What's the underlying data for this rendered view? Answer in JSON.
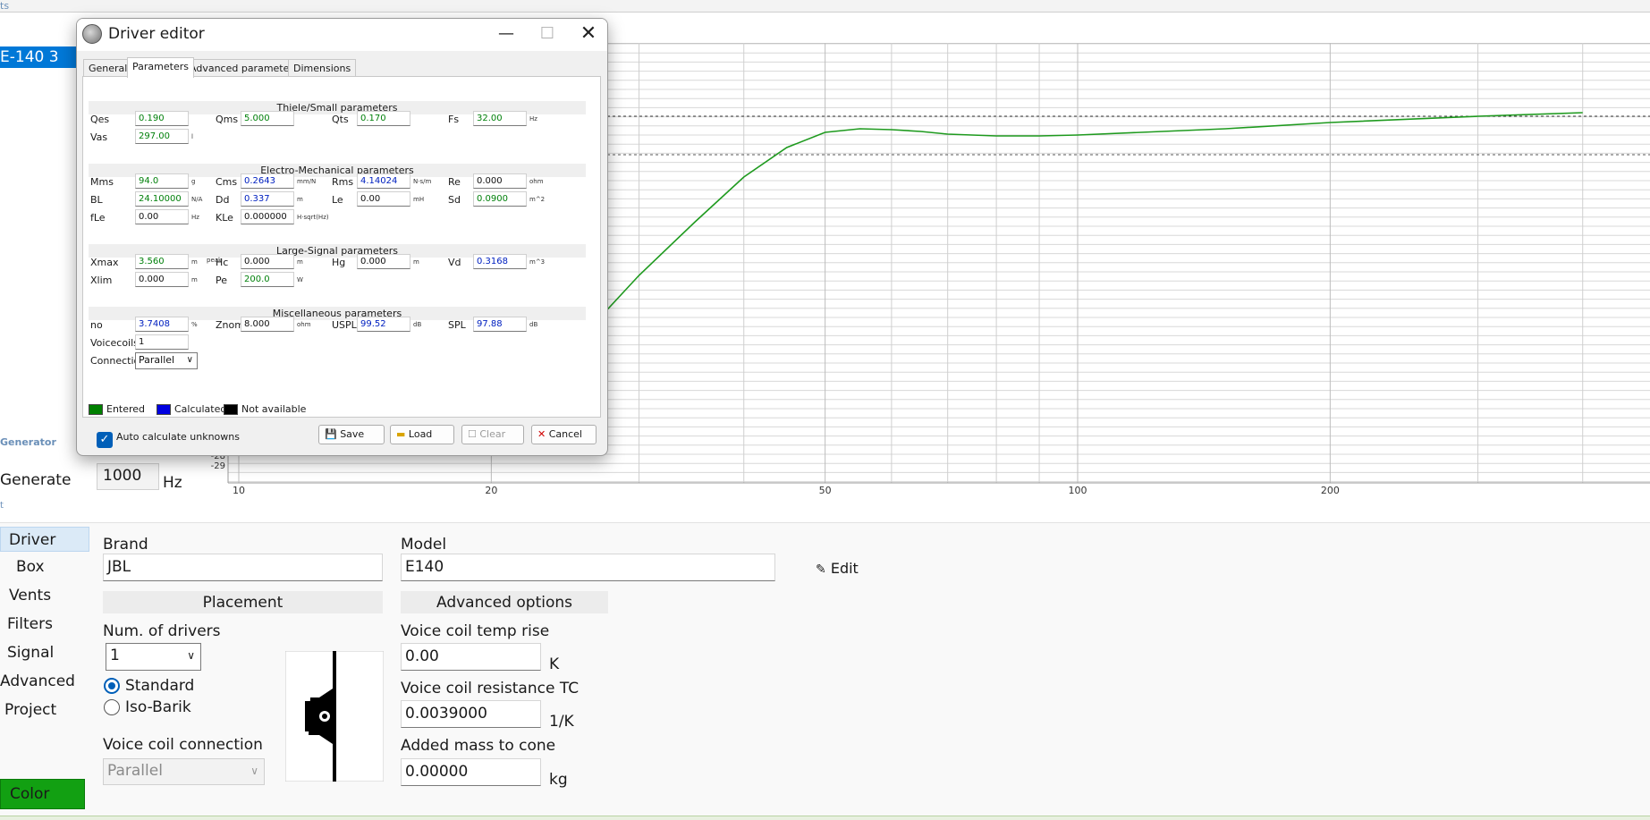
{
  "topstrip": {
    "text": "ts"
  },
  "project_list": {
    "selected": "E-140 3"
  },
  "generator": {
    "section_label": "Generator",
    "generate_label": "Generate",
    "frequency": "1000",
    "frequency_unit": "Hz",
    "marker": "t"
  },
  "chart_data": {
    "type": "line",
    "x_axis": {
      "scale": "log",
      "range": [
        8,
        400
      ],
      "tick_labels": [
        "10",
        "20",
        "50",
        "100",
        "200"
      ]
    },
    "y_axis": {
      "visible_tick_labels": [
        "-28",
        "-29"
      ]
    },
    "grid": true,
    "reference_lines": [
      {
        "style": "dashed"
      },
      {
        "style": "dashed"
      }
    ],
    "series": [
      {
        "color": "#1e9a1e",
        "x": [
          21,
          25,
          30,
          35,
          40,
          45,
          50,
          55,
          60,
          65,
          70,
          80,
          90,
          100,
          150,
          200,
          300,
          400
        ],
        "y": [
          -29,
          -22,
          -14,
          -8,
          -3,
          0.3,
          2.0,
          2.4,
          2.3,
          2.1,
          1.8,
          1.6,
          1.6,
          1.7,
          2.4,
          3.1,
          3.8,
          4.2
        ]
      }
    ]
  },
  "nav": {
    "driver": "Driver",
    "box": "Box",
    "vents": "Vents",
    "filters": "Filters",
    "signal": "Signal",
    "advanced": "Advanced",
    "project": "Project",
    "color": "Color"
  },
  "driver_tab": {
    "brand_label": "Brand",
    "brand_value": "JBL",
    "model_label": "Model",
    "model_value": "E140",
    "edit_label": "Edit",
    "placement_header": "Placement",
    "num_drivers_label": "Num. of drivers",
    "num_drivers_value": "1",
    "standard_label": "Standard",
    "isobarik_label": "Iso-Barik",
    "vc_connection_label": "Voice coil connection",
    "vc_connection_value": "Parallel",
    "advanced_header": "Advanced options",
    "vc_temp_label": "Voice coil temp rise",
    "vc_temp_value": "0.00",
    "vc_temp_unit": "K",
    "vc_res_label": "Voice coil resistance TC",
    "vc_res_value": "0.0039000",
    "vc_res_unit": "1/K",
    "added_mass_label": "Added mass to cone",
    "added_mass_value": "0.00000",
    "added_mass_unit": "kg"
  },
  "dialog": {
    "title": "Driver editor",
    "tabs": {
      "general": "General",
      "parameters": "Parameters",
      "advanced": "Advanced parameters",
      "dimensions": "Dimensions"
    },
    "groups": {
      "ts": "Thiele/Small parameters",
      "em": "Electro-Mechanical parameters",
      "ls": "Large-Signal parameters",
      "misc": "Miscellaneous parameters"
    },
    "params": {
      "qes": {
        "label": "Qes",
        "value": "0.190"
      },
      "qms": {
        "label": "Qms",
        "value": "5.000"
      },
      "qts": {
        "label": "Qts",
        "value": "0.170"
      },
      "fs": {
        "label": "Fs",
        "value": "32.00",
        "unit": "Hz"
      },
      "vas": {
        "label": "Vas",
        "value": "297.00",
        "unit": "l"
      },
      "mms": {
        "label": "Mms",
        "value": "94.0",
        "unit": "g"
      },
      "cms": {
        "label": "Cms",
        "value": "0.2643",
        "unit": "mm/N"
      },
      "rms": {
        "label": "Rms",
        "value": "4.14024",
        "unit": "N·s/m"
      },
      "re": {
        "label": "Re",
        "value": "0.000",
        "unit": "ohm"
      },
      "bl": {
        "label": "BL",
        "value": "24.10000",
        "unit": "N/A"
      },
      "dd": {
        "label": "Dd",
        "value": "0.337",
        "unit": "m"
      },
      "le": {
        "label": "Le",
        "value": "0.00",
        "unit": "mH"
      },
      "sd": {
        "label": "Sd",
        "value": "0.0900",
        "unit": "m^2"
      },
      "fle": {
        "label": "fLe",
        "value": "0.00",
        "unit": "Hz"
      },
      "kle": {
        "label": "KLe",
        "value": "0.000000",
        "unit": "H·sqrt(Hz)"
      },
      "xmax": {
        "label": "Xmax",
        "value": "3.560",
        "unit": "m",
        "extra": "peak"
      },
      "hc": {
        "label": "Hc",
        "value": "0.000",
        "unit": "m"
      },
      "hg": {
        "label": "Hg",
        "value": "0.000",
        "unit": "m"
      },
      "vd": {
        "label": "Vd",
        "value": "0.3168",
        "unit": "m^3"
      },
      "xlim": {
        "label": "Xlim",
        "value": "0.000",
        "unit": "m"
      },
      "pe": {
        "label": "Pe",
        "value": "200.0",
        "unit": "W"
      },
      "no": {
        "label": "no",
        "value": "3.7408",
        "unit": "%"
      },
      "znom": {
        "label": "Znom",
        "value": "8.000",
        "unit": "ohm"
      },
      "uspl": {
        "label": "USPL",
        "value": "99.52",
        "unit": "dB"
      },
      "spl": {
        "label": "SPL",
        "value": "97.88",
        "unit": "dB"
      },
      "voicecoils": {
        "label": "Voicecoils",
        "value": "1"
      },
      "connection": {
        "label": "Connection",
        "value": "Parallel"
      }
    },
    "legend": {
      "entered": "Entered",
      "calculated": "Calculated",
      "na": "Not available",
      "entered_color": "#008000",
      "calculated_color": "#0000e0",
      "na_color": "#000000"
    },
    "autocalc_label": "Auto calculate unknowns",
    "buttons": {
      "save": "Save",
      "load": "Load",
      "clear": "Clear",
      "cancel": "Cancel"
    }
  }
}
